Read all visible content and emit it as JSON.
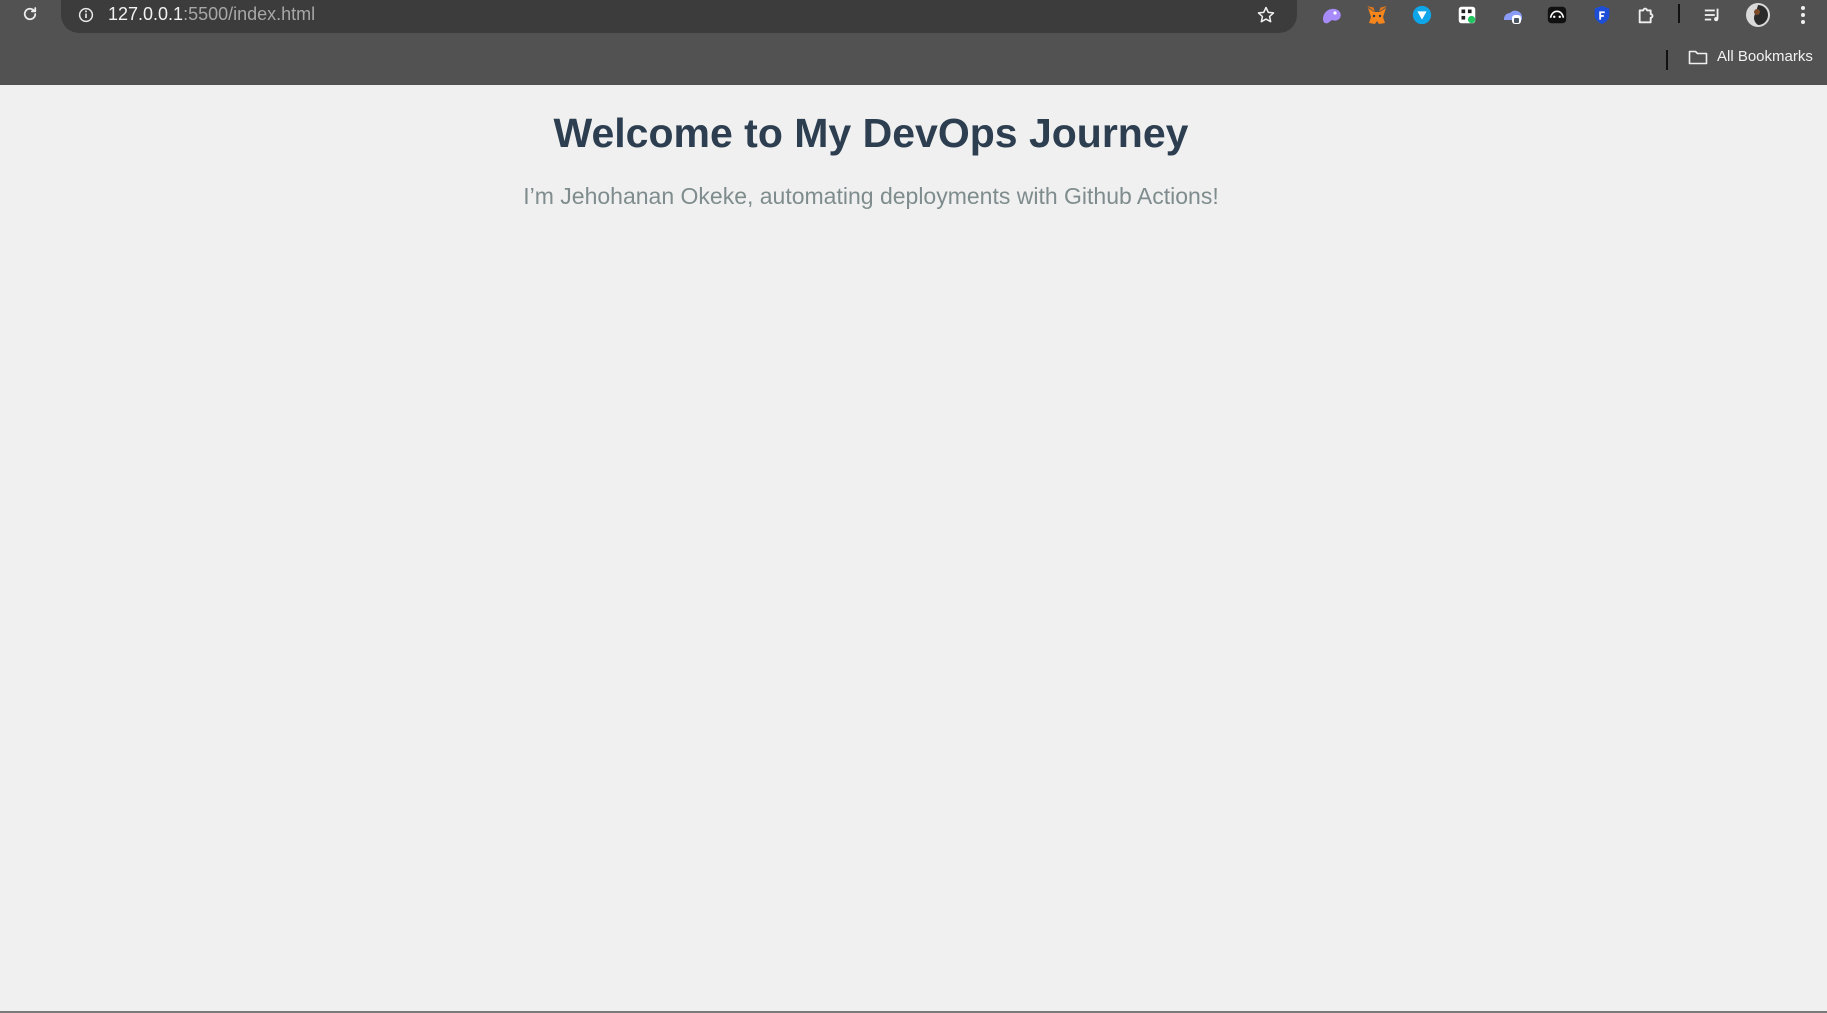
{
  "browser": {
    "url_host": "127.0.0.1",
    "url_path": ":5500/index.html",
    "toolbar_icons": [
      "reload-icon",
      "site-info-icon",
      "bookmark-star-icon",
      "ai-extension-icon",
      "metamask-extension-icon",
      "shield-extension-icon",
      "cookie-extension-icon",
      "cloud-extension-icon",
      "cat-extension-icon",
      "blue-shield-extension-icon",
      "extensions-puzzle-icon",
      "media-controls-icon",
      "profile-avatar",
      "more-menu-icon"
    ],
    "bookmarks_label": "All Bookmarks"
  },
  "page": {
    "title": "Welcome to My DevOps Journey",
    "subtitle": "I’m Jehohanan Okeke, automating deployments with Github Actions!"
  },
  "colors": {
    "chrome_background": "#525252",
    "omnibox_background": "#3c3c3c",
    "page_background": "#f0f0f0",
    "title_color": "#2c3e50",
    "subtitle_color": "#7f8c8d"
  }
}
